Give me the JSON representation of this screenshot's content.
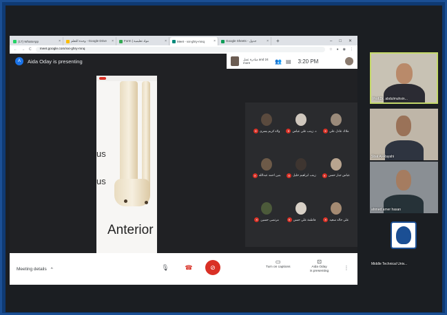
{
  "browser": {
    "tabs": [
      {
        "label": "(17) WhatsApp",
        "color": "#25d366"
      },
      {
        "label": "وحدة التعلم - Google Drive",
        "color": "#fbbc04"
      },
      {
        "label": "Form | مواد تعليمية",
        "color": "#34a853"
      },
      {
        "label": "Meet - vxi-ghry-mnq",
        "color": "#00897b"
      },
      {
        "label": "Google Sheets - جدول",
        "color": "#0f9d58"
      }
    ],
    "url": "meet.google.com/vxi-ghry-mnq"
  },
  "meet": {
    "presenter_initial": "A",
    "presenting_text": "Aida Oday is presenting",
    "others_text": "مبادرة عمل and 24 more",
    "time": "3:20 PM"
  },
  "slide": {
    "us_top": "us",
    "us_bottom": "us",
    "anterior": "Anterior"
  },
  "participants": [
    {
      "name": "ولاء كريم يسرى",
      "color": "#5a4a3e"
    },
    {
      "name": "د. زينب علي عباس",
      "color": "#cfc7bd"
    },
    {
      "name": "ملاك عادل علي",
      "color": "#9a8a7a"
    },
    {
      "name": "بنين احمد عبدالله",
      "color": "#6d5a48"
    },
    {
      "name": "زينب ابراهيم خليل",
      "color": "#3e3530"
    },
    {
      "name": "عباس جبار حسن",
      "color": "#b8a48f"
    },
    {
      "name": "مرتضى حسين",
      "color": "#4c5a3a"
    },
    {
      "name": "فاطمة علي حسن",
      "color": "#d8d0c6"
    },
    {
      "name": "علي خالد سعيد",
      "color": "#a48a72"
    }
  ],
  "bottom": {
    "meeting_details": "Meeting details",
    "chevron": "^",
    "captions": "Turn on captions",
    "presenting_line1": "Aida Oday",
    "presenting_line2": "is presenting"
  },
  "videos": [
    {
      "label": "Prof.Dr. abdulmuhsin...",
      "bg": "#c8c2b4",
      "head": "#b98a6a",
      "body": "#2b2b33"
    },
    {
      "label": "Sbat Al-Rayahi",
      "bg": "#bfb6a8",
      "head": "#9a7258",
      "body": "#2e3440"
    },
    {
      "label": "ahmed amer hasan",
      "bg": "#8a8f94",
      "head": "#a57c60",
      "body": "#263238"
    },
    {
      "label": "Middle Technical Univ...",
      "bg": "#1b1e22"
    }
  ]
}
